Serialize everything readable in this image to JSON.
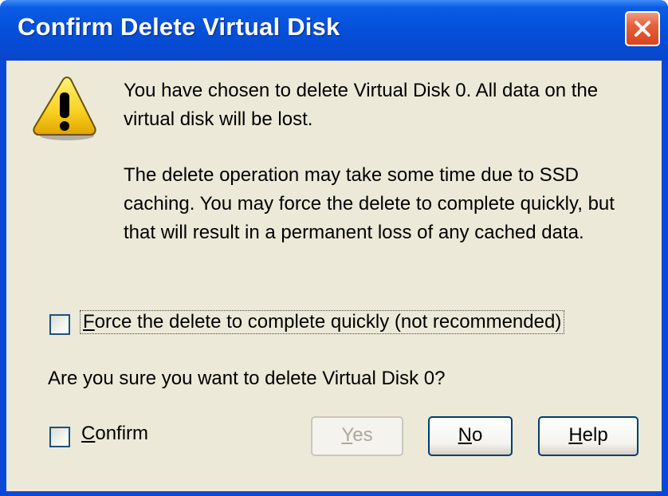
{
  "dialog": {
    "title": "Confirm Delete Virtual Disk",
    "icon": "warning-icon"
  },
  "message": {
    "line1": "You have chosen to delete Virtual Disk 0. All data on the virtual disk will be lost.",
    "line2": "The delete operation may take some time due to SSD caching. You may force the delete to complete quickly, but that will result in a permanent loss of any cached data."
  },
  "force_option": {
    "label_hotkey": "F",
    "label_rest": "orce the delete to complete quickly (not recommended)",
    "checked": false
  },
  "question": "Are you sure you want to delete Virtual Disk 0?",
  "confirm_option": {
    "label_hotkey": "C",
    "label_rest": "onfirm",
    "checked": false
  },
  "buttons": {
    "yes": {
      "hotkey": "Y",
      "rest": "es",
      "enabled": false
    },
    "no": {
      "hotkey": "N",
      "rest": "o",
      "enabled": true
    },
    "help": {
      "hotkey": "H",
      "rest": "elp",
      "enabled": true
    }
  },
  "colors": {
    "titlebar": "#0551da",
    "client": "#ece9d8",
    "close_button": "#e5603a",
    "warning_yellow": "#f8d020"
  }
}
